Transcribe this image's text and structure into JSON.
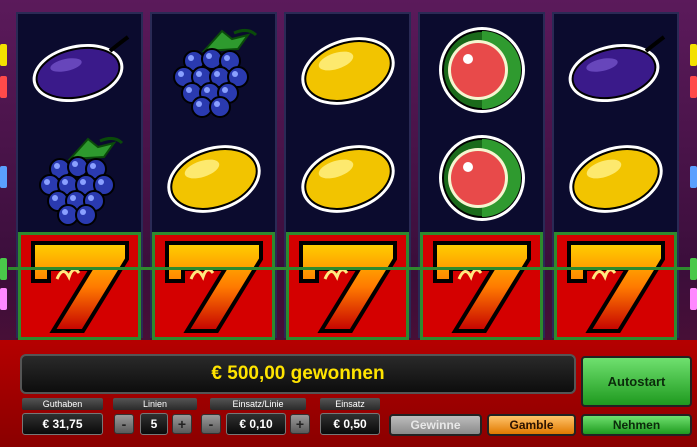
{
  "status": {
    "message": "€ 500,00 gewonnen"
  },
  "controls": {
    "guthaben": {
      "label": "Guthaben",
      "value": "€ 31,75"
    },
    "linien": {
      "label": "Linien",
      "value": "5"
    },
    "einsatz_linie": {
      "label": "Einsatz/Linie",
      "value": "€ 0,10"
    },
    "einsatz": {
      "label": "Einsatz",
      "value": "€ 0,50"
    },
    "minus": "-",
    "plus": "+"
  },
  "buttons": {
    "autostart": "Autostart",
    "gewinne": "Gewinne",
    "gamble": "Gamble",
    "nehmen": "Nehmen"
  },
  "reels": [
    [
      "plum",
      "grapes",
      "seven"
    ],
    [
      "grapes",
      "lemon",
      "seven"
    ],
    [
      "lemon",
      "lemon",
      "seven"
    ],
    [
      "watermelon",
      "watermelon",
      "seven"
    ],
    [
      "plum",
      "lemon",
      "seven"
    ]
  ],
  "winning_row": 3,
  "colors": {
    "panel": "#b50000",
    "win_cell": "#d40000",
    "payline": "#2e8a2e",
    "message_text": "#ffe400",
    "reel_bg": "#0b0b2e"
  }
}
